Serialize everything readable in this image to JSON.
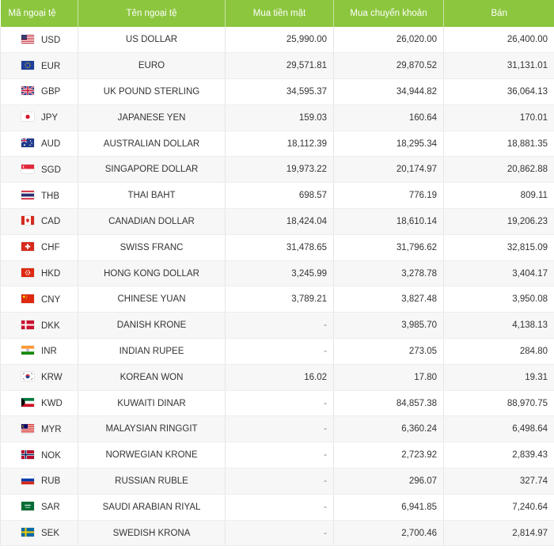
{
  "headers": {
    "code": "Mã ngoại tệ",
    "name": "Tên ngoại tệ",
    "cash_buy": "Mua tiền mặt",
    "transfer_buy": "Mua chuyển khoản",
    "sell": "Bán"
  },
  "rows": [
    {
      "code": "USD",
      "name": "US DOLLAR",
      "cash_buy": "25,990.00",
      "transfer_buy": "26,020.00",
      "sell": "26,400.00",
      "flag": "us-flag-icon"
    },
    {
      "code": "EUR",
      "name": "EURO",
      "cash_buy": "29,571.81",
      "transfer_buy": "29,870.52",
      "sell": "31,131.01",
      "flag": "eu-flag-icon"
    },
    {
      "code": "GBP",
      "name": "UK POUND STERLING",
      "cash_buy": "34,595.37",
      "transfer_buy": "34,944.82",
      "sell": "36,064.13",
      "flag": "uk-flag-icon"
    },
    {
      "code": "JPY",
      "name": "JAPANESE YEN",
      "cash_buy": "159.03",
      "transfer_buy": "160.64",
      "sell": "170.01",
      "flag": "japan-flag-icon"
    },
    {
      "code": "AUD",
      "name": "AUSTRALIAN DOLLAR",
      "cash_buy": "18,112.39",
      "transfer_buy": "18,295.34",
      "sell": "18,881.35",
      "flag": "australia-flag-icon"
    },
    {
      "code": "SGD",
      "name": "SINGAPORE DOLLAR",
      "cash_buy": "19,973.22",
      "transfer_buy": "20,174.97",
      "sell": "20,862.88",
      "flag": "singapore-flag-icon"
    },
    {
      "code": "THB",
      "name": "THAI BAHT",
      "cash_buy": "698.57",
      "transfer_buy": "776.19",
      "sell": "809.11",
      "flag": "thailand-flag-icon"
    },
    {
      "code": "CAD",
      "name": "CANADIAN DOLLAR",
      "cash_buy": "18,424.04",
      "transfer_buy": "18,610.14",
      "sell": "19,206.23",
      "flag": "canada-flag-icon"
    },
    {
      "code": "CHF",
      "name": "SWISS FRANC",
      "cash_buy": "31,478.65",
      "transfer_buy": "31,796.62",
      "sell": "32,815.09",
      "flag": "switzerland-flag-icon"
    },
    {
      "code": "HKD",
      "name": "HONG KONG DOLLAR",
      "cash_buy": "3,245.99",
      "transfer_buy": "3,278.78",
      "sell": "3,404.17",
      "flag": "hongkong-flag-icon"
    },
    {
      "code": "CNY",
      "name": "CHINESE YUAN",
      "cash_buy": "3,789.21",
      "transfer_buy": "3,827.48",
      "sell": "3,950.08",
      "flag": "china-flag-icon"
    },
    {
      "code": "DKK",
      "name": "DANISH KRONE",
      "cash_buy": "-",
      "transfer_buy": "3,985.70",
      "sell": "4,138.13",
      "flag": "denmark-flag-icon"
    },
    {
      "code": "INR",
      "name": "INDIAN RUPEE",
      "cash_buy": "-",
      "transfer_buy": "273.05",
      "sell": "284.80",
      "flag": "india-flag-icon"
    },
    {
      "code": "KRW",
      "name": "KOREAN WON",
      "cash_buy": "16.02",
      "transfer_buy": "17.80",
      "sell": "19.31",
      "flag": "korea-flag-icon"
    },
    {
      "code": "KWD",
      "name": "KUWAITI DINAR",
      "cash_buy": "-",
      "transfer_buy": "84,857.38",
      "sell": "88,970.75",
      "flag": "kuwait-flag-icon"
    },
    {
      "code": "MYR",
      "name": "MALAYSIAN RINGGIT",
      "cash_buy": "-",
      "transfer_buy": "6,360.24",
      "sell": "6,498.64",
      "flag": "malaysia-flag-icon"
    },
    {
      "code": "NOK",
      "name": "NORWEGIAN KRONE",
      "cash_buy": "-",
      "transfer_buy": "2,723.92",
      "sell": "2,839.43",
      "flag": "norway-flag-icon"
    },
    {
      "code": "RUB",
      "name": "RUSSIAN RUBLE",
      "cash_buy": "-",
      "transfer_buy": "296.07",
      "sell": "327.74",
      "flag": "russia-flag-icon"
    },
    {
      "code": "SAR",
      "name": "SAUDI ARABIAN RIYAL",
      "cash_buy": "-",
      "transfer_buy": "6,941.85",
      "sell": "7,240.64",
      "flag": "saudi-flag-icon"
    },
    {
      "code": "SEK",
      "name": "SWEDISH KRONA",
      "cash_buy": "-",
      "transfer_buy": "2,700.46",
      "sell": "2,814.97",
      "flag": "sweden-flag-icon"
    }
  ],
  "colors": {
    "header_bg": "#8cc63e",
    "header_text": "#ffffff",
    "row_alt_bg": "#f7f7f7"
  }
}
